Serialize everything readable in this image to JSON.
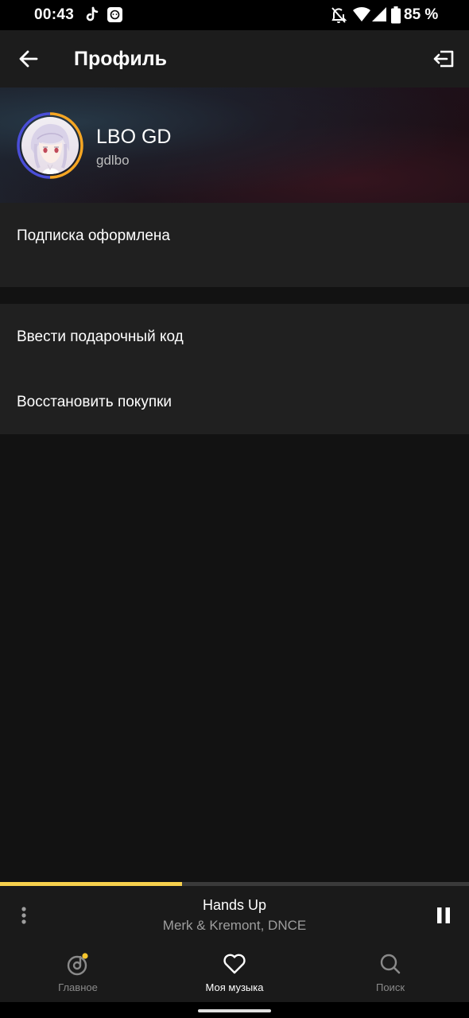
{
  "status_bar": {
    "time": "00:43",
    "battery": "85 %",
    "icons": [
      "tiktok-icon",
      "notification-app-icon",
      "do-not-disturb-icon",
      "wifi-icon",
      "signal-icon",
      "battery-icon"
    ]
  },
  "app_bar": {
    "title": "Профиль",
    "back_icon": "arrow-left-icon",
    "logout_icon": "logout-icon"
  },
  "profile": {
    "name": "LBO GD",
    "login": "gdlbo",
    "ring_colors": [
      "#4a4ed8",
      "#f6a623"
    ]
  },
  "sections": {
    "subscription": "Подписка оформлена",
    "gift_code": "Ввести подарочный код",
    "restore": "Восстановить покупки"
  },
  "player": {
    "title": "Hands Up",
    "artist": "Merk & Kremont, DNCE",
    "progress": 0.388,
    "progress_color": "#f6d04d"
  },
  "bottom_nav": {
    "items": [
      {
        "label": "Главное",
        "icon": "disc-note-icon",
        "active": false
      },
      {
        "label": "Моя музыка",
        "icon": "heart-icon",
        "active": true
      },
      {
        "label": "Поиск",
        "icon": "search-icon",
        "active": false
      }
    ],
    "active_color": "#ffffff",
    "inactive_color": "#8a8a8a",
    "badge_color": "#f6c52d"
  }
}
